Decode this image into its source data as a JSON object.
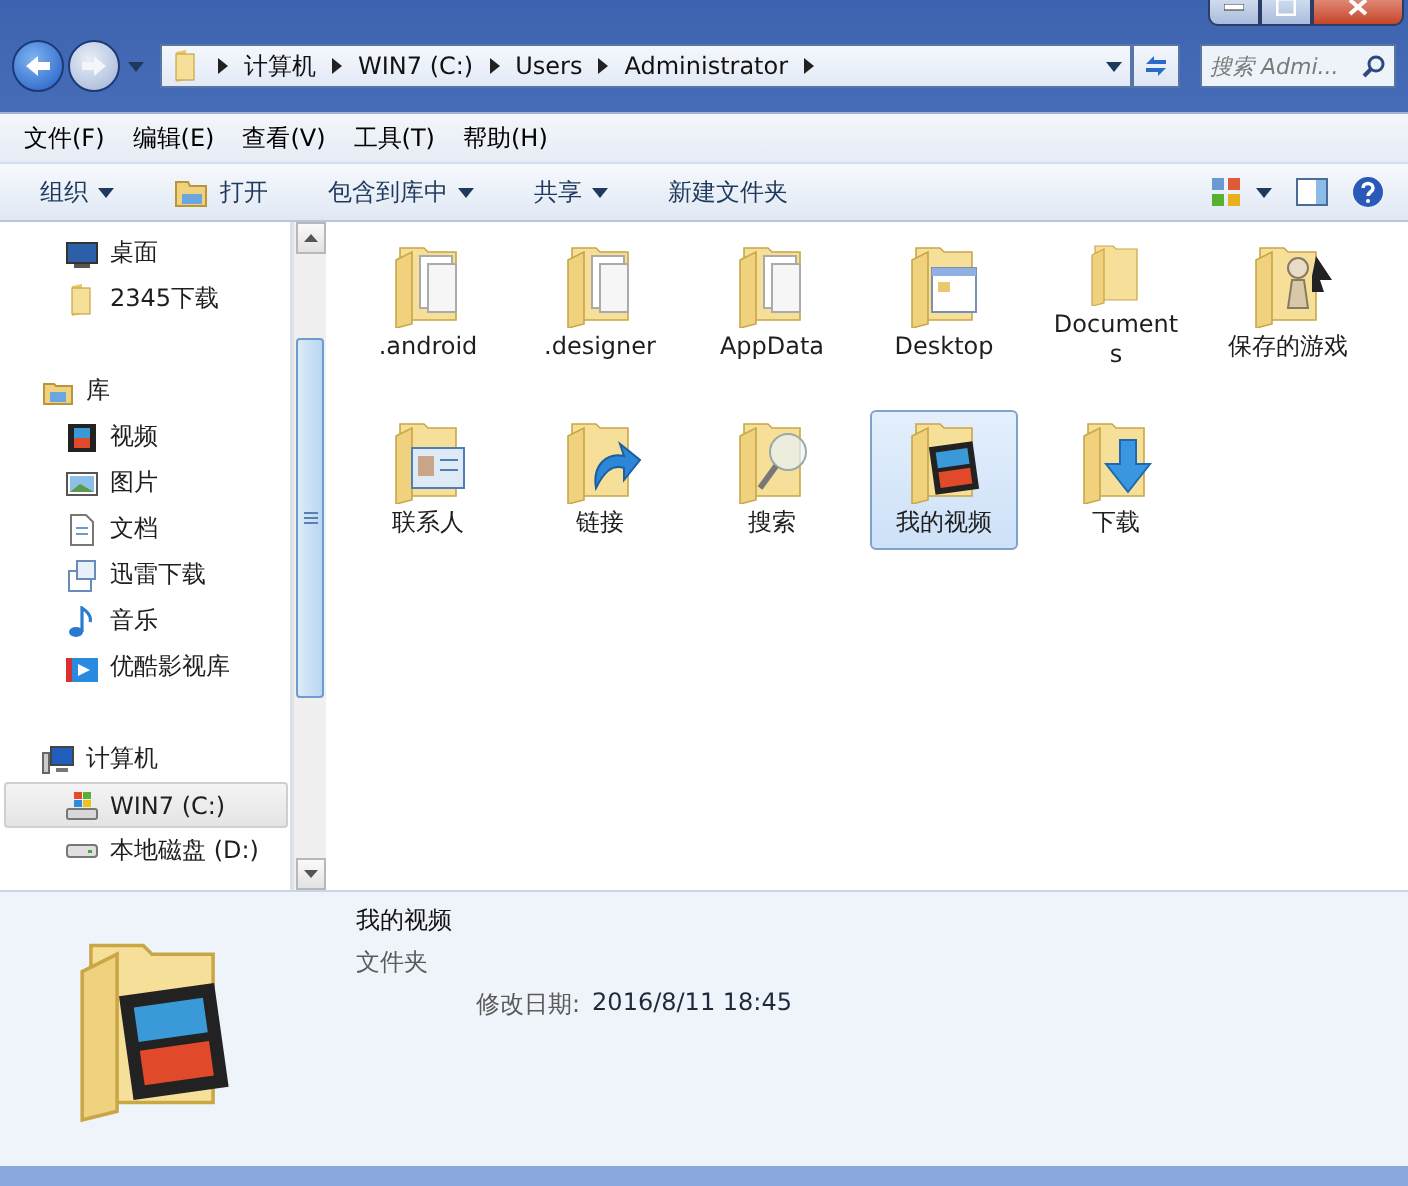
{
  "address": {
    "segments": [
      "计算机",
      "WIN7 (C:)",
      "Users",
      "Administrator"
    ]
  },
  "search": {
    "placeholder": "搜索 Admi..."
  },
  "menu": [
    "文件(F)",
    "编辑(E)",
    "查看(V)",
    "工具(T)",
    "帮助(H)"
  ],
  "toolbar": [
    {
      "label": "组织",
      "kind": "dropdown"
    },
    {
      "label": "打开",
      "kind": "open"
    },
    {
      "label": "包含到库中",
      "kind": "dropdown"
    },
    {
      "label": "共享",
      "kind": "dropdown"
    },
    {
      "label": "新建文件夹",
      "kind": "plain"
    }
  ],
  "sidebar": {
    "sections": [
      {
        "children": [
          {
            "label": "桌面",
            "kind": "desktop",
            "selected": false
          },
          {
            "label": "2345下载",
            "kind": "folder",
            "selected": false
          }
        ]
      },
      {
        "label": "库",
        "kind": "library",
        "children": [
          {
            "label": "视频",
            "kind": "video",
            "selected": false
          },
          {
            "label": "图片",
            "kind": "picture",
            "selected": false
          },
          {
            "label": "文档",
            "kind": "document",
            "selected": false
          },
          {
            "label": "迅雷下载",
            "kind": "download",
            "selected": false
          },
          {
            "label": "音乐",
            "kind": "music",
            "selected": false
          },
          {
            "label": "优酷影视库",
            "kind": "youku",
            "selected": false
          }
        ]
      },
      {
        "label": "计算机",
        "kind": "computer",
        "children": [
          {
            "label": "WIN7 (C:)",
            "kind": "system-drive",
            "selected": true
          },
          {
            "label": "本地磁盘 (D:)",
            "kind": "drive",
            "selected": false
          }
        ]
      }
    ]
  },
  "files": [
    {
      "name": ".android",
      "kind": "papers",
      "selected": false
    },
    {
      "name": ".designer",
      "kind": "papers",
      "selected": false
    },
    {
      "name": "AppData",
      "kind": "papers",
      "selected": false
    },
    {
      "name": "Desktop",
      "kind": "windows",
      "selected": false
    },
    {
      "name": "Documents",
      "kind": "plain",
      "selected": false
    },
    {
      "name": "保存的游戏",
      "kind": "games",
      "selected": false
    },
    {
      "name": "联系人",
      "kind": "contact",
      "selected": false
    },
    {
      "name": "链接",
      "kind": "link",
      "selected": false
    },
    {
      "name": "搜索",
      "kind": "search",
      "selected": false
    },
    {
      "name": "我的视频",
      "kind": "video",
      "selected": true
    },
    {
      "name": "下载",
      "kind": "download",
      "selected": false
    }
  ],
  "details": {
    "name": "我的视频",
    "type": "文件夹",
    "date_label": "修改日期:",
    "date": "2016/8/11 18:45",
    "kind": "video"
  }
}
